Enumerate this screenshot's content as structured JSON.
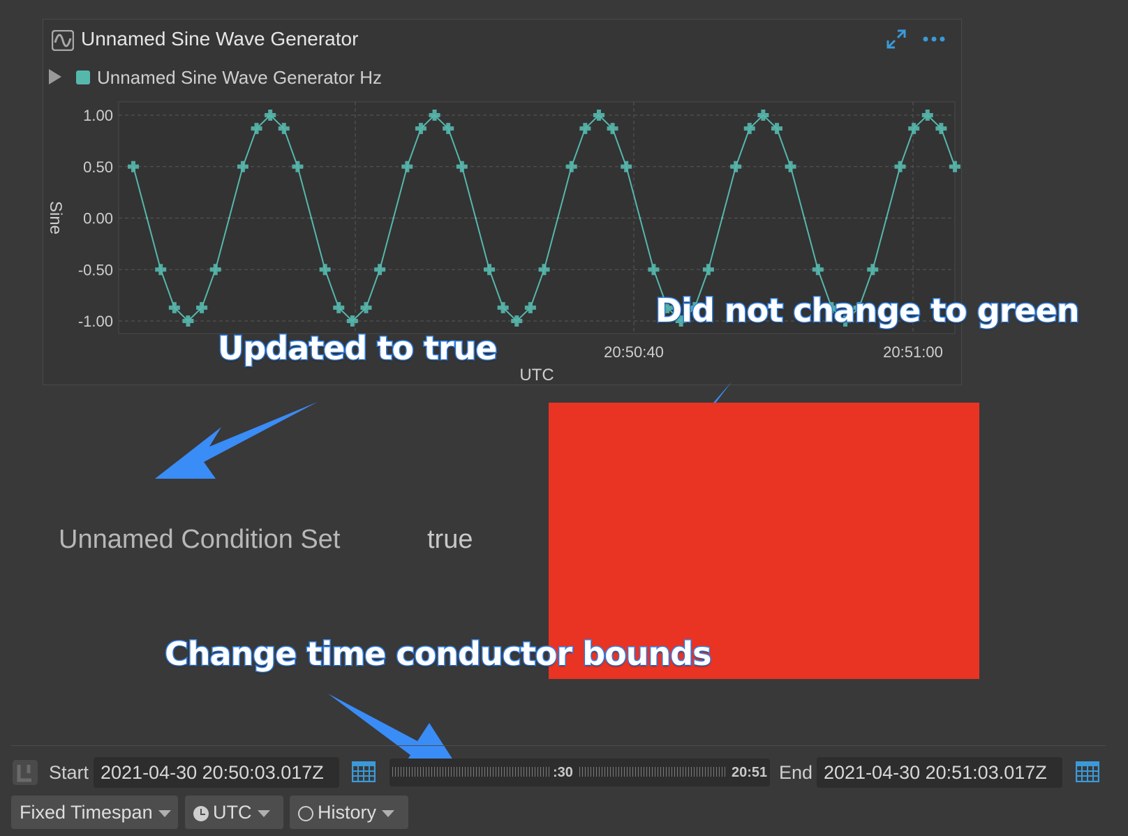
{
  "plot": {
    "title": "Unnamed Sine Wave Generator",
    "icon": "sine-wave-icon",
    "legend_label": "Unnamed Sine Wave Generator Hz",
    "series_color": "#56b8ad"
  },
  "chart_data": {
    "type": "line",
    "ylabel": "Sine",
    "xlabel": "UTC",
    "ylim": [
      -1.0,
      1.0
    ],
    "y_ticks": [
      "1.00",
      "0.50",
      "0.00",
      "-0.50",
      "-1.00"
    ],
    "x_ticks": [
      "20:50:40",
      "20:51:00"
    ],
    "grid": true,
    "series": [
      {
        "name": "Unnamed Sine Wave Generator Hz",
        "x": [
          0.0,
          1.0,
          2.0,
          3.0,
          4.0,
          5.0,
          6.0,
          7.0,
          8.0,
          9.0,
          10.0,
          11.0,
          12.0,
          13.0,
          14.0,
          15.0,
          16.0,
          17.0,
          18.0,
          19.0,
          20.0,
          21.0,
          22.0,
          23.0,
          24.0,
          25.0,
          26.0,
          27.0,
          28.0,
          29.0,
          30.0,
          31.0,
          32.0,
          33.0,
          34.0,
          35.0,
          36.0,
          37.0,
          38.0,
          39.0,
          40.0,
          41.0,
          42.0,
          43.0,
          44.0,
          45.0,
          46.0,
          47.0,
          48.0,
          49.0,
          50.0,
          51.0,
          52.0,
          53.0,
          54.0,
          55.0,
          56.0,
          57.0,
          58.0,
          59.0,
          60.0
        ],
        "y": [
          0.5,
          0.0,
          -0.5,
          -0.87,
          -1.0,
          -0.87,
          -0.5,
          0.0,
          0.5,
          0.87,
          1.0,
          0.87,
          0.5,
          0.0,
          -0.5,
          -0.87,
          -1.0,
          -0.87,
          -0.5,
          0.0,
          0.5,
          0.87,
          1.0,
          0.87,
          0.5,
          0.0,
          -0.5,
          -0.87,
          -1.0,
          -0.87,
          -0.5,
          0.0,
          0.5,
          0.87,
          1.0,
          0.87,
          0.5,
          0.0,
          -0.5,
          -0.87,
          -1.0,
          -0.87,
          -0.5,
          0.0,
          0.5,
          0.87,
          1.0,
          0.87,
          0.5,
          0.0,
          -0.5,
          -0.87,
          -1.0,
          -0.87,
          -0.5,
          0.0,
          0.5,
          0.87,
          1.0,
          0.87,
          0.5
        ]
      }
    ]
  },
  "annotations": {
    "updated": "Updated to true",
    "not_green": "Did not change to green",
    "bounds": "Change time conductor bounds",
    "arrow_color": "#3a8cf7"
  },
  "condition": {
    "label": "Unnamed Condition Set",
    "value": "true",
    "status_color": "#e93323"
  },
  "time_conductor": {
    "start_label": "Start",
    "start_value": "2021-04-30 20:50:03.017Z",
    "end_label": "End",
    "end_value": "2021-04-30 20:51:03.017Z",
    "timeline_ticks": [
      ":30",
      "20:51"
    ],
    "mode": "Fixed Timespan",
    "timezone": "UTC",
    "history": "History"
  }
}
